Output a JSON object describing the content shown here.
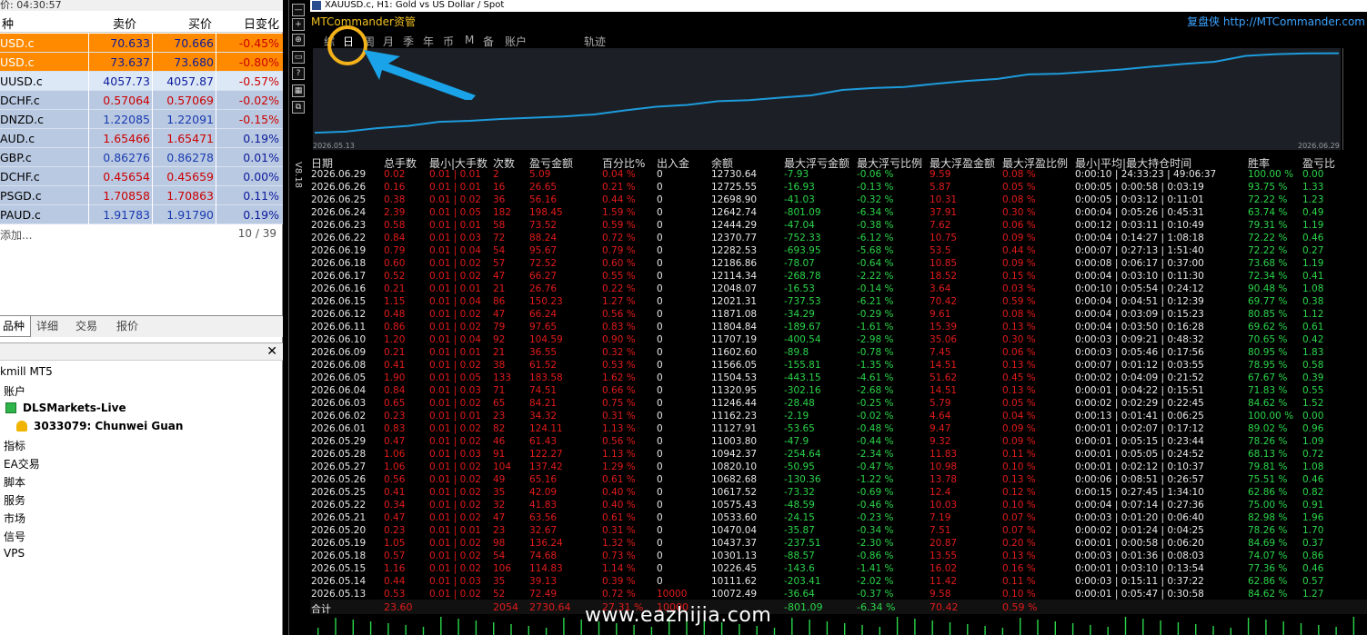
{
  "market_watch": {
    "time_label": "价: 04:30:57",
    "headers": {
      "symbol": "种",
      "bid": "卖价",
      "ask": "买价",
      "change": "日变化"
    },
    "rows": [
      {
        "symbol": "USD.c",
        "bid": "70.633",
        "ask": "70.666",
        "change": "-0.45%",
        "bg": "#ff8a00",
        "change_color": "#cc0000",
        "price_color": "#0b1a9a"
      },
      {
        "symbol": "USD.c",
        "bid": "73.637",
        "ask": "73.680",
        "change": "-0.80%",
        "bg": "#ff8a00",
        "change_color": "#cc0000",
        "price_color": "#0b1a9a"
      },
      {
        "symbol": "UUSD.c",
        "bid": "4057.73",
        "ask": "4057.87",
        "change": "-0.57%",
        "bg": "#dde8f7",
        "change_color": "#cc0000",
        "price_color": "#0b1a9a"
      },
      {
        "symbol": "DCHF.c",
        "bid": "0.57064",
        "ask": "0.57069",
        "change": "-0.02%",
        "bg": "#b9c9e2",
        "change_color": "#cc0000",
        "price_color": "#cc0000"
      },
      {
        "symbol": "DNZD.c",
        "bid": "1.22085",
        "ask": "1.22091",
        "change": "-0.15%",
        "bg": "#b9c9e2",
        "change_color": "#cc0000",
        "price_color": "#1a3ab0"
      },
      {
        "symbol": "AUD.c",
        "bid": "1.65466",
        "ask": "1.65471",
        "change": "0.19%",
        "bg": "#b9c9e2",
        "change_color": "#0b1a9a",
        "price_color": "#cc0000"
      },
      {
        "symbol": "GBP.c",
        "bid": "0.86276",
        "ask": "0.86278",
        "change": "0.01%",
        "bg": "#b9c9e2",
        "change_color": "#0b1a9a",
        "price_color": "#1a3ab0"
      },
      {
        "symbol": "DCHF.c",
        "bid": "0.45654",
        "ask": "0.45659",
        "change": "0.00%",
        "bg": "#b9c9e2",
        "change_color": "#0b1a9a",
        "price_color": "#cc0000"
      },
      {
        "symbol": "PSGD.c",
        "bid": "1.70858",
        "ask": "1.70863",
        "change": "0.11%",
        "bg": "#b9c9e2",
        "change_color": "#0b1a9a",
        "price_color": "#cc0000"
      },
      {
        "symbol": "PAUD.c",
        "bid": "1.91783",
        "ask": "1.91790",
        "change": "0.19%",
        "bg": "#b9c9e2",
        "change_color": "#0b1a9a",
        "price_color": "#1a3ab0"
      }
    ],
    "add_label": "添加...",
    "count": "10 / 39",
    "tabs": [
      "品种",
      "详细",
      "交易",
      "报价"
    ]
  },
  "navigator": {
    "items": [
      {
        "label": "kmill MT5",
        "bold": false,
        "icon": ""
      },
      {
        "label": "账户",
        "bold": false,
        "icon": ""
      },
      {
        "label": "DLSMarkets-Live",
        "bold": true,
        "icon": "server-icon"
      },
      {
        "label": "3033079: Chunwei Guan",
        "bold": true,
        "icon": "user-icon"
      },
      {
        "label": "指标",
        "bold": false,
        "icon": ""
      },
      {
        "label": "EA交易",
        "bold": false,
        "icon": ""
      },
      {
        "label": "脚本",
        "bold": false,
        "icon": ""
      },
      {
        "label": "服务",
        "bold": false,
        "icon": ""
      },
      {
        "label": "市场",
        "bold": false,
        "icon": ""
      },
      {
        "label": "信号",
        "bold": false,
        "icon": ""
      },
      {
        "label": "VPS",
        "bold": false,
        "icon": ""
      }
    ]
  },
  "chart": {
    "title": "XAUUSD.c, H1:  Gold vs US Dollar / Spot",
    "mtc_label": "MTCommander资管",
    "site_label": "复盘侠 http://MTCommander.com",
    "menu": [
      "综",
      "日",
      "周",
      "月",
      "季",
      "年",
      "币",
      "M",
      "备",
      "账户",
      "轨迹"
    ],
    "version": "V8.18",
    "date_start": "2026.05.13",
    "date_end": "2026.06.29",
    "watermark": "www.eazhijia.com"
  },
  "chart_data": {
    "type": "line",
    "title": "",
    "x": [
      "2026.05.13",
      "2026.05.14",
      "2026.05.15",
      "2026.05.18",
      "2026.05.19",
      "2026.05.20",
      "2026.05.21",
      "2026.05.22",
      "2026.05.25",
      "2026.05.26",
      "2026.05.27",
      "2026.05.28",
      "2026.05.29",
      "2026.06.01",
      "2026.06.02",
      "2026.06.03",
      "2026.06.04",
      "2026.06.05",
      "2026.06.08",
      "2026.06.09",
      "2026.06.10",
      "2026.06.11",
      "2026.06.12",
      "2026.06.15",
      "2026.06.16",
      "2026.06.17",
      "2026.06.18",
      "2026.06.19",
      "2026.06.22",
      "2026.06.23",
      "2026.06.24",
      "2026.06.25",
      "2026.06.26",
      "2026.06.29"
    ],
    "series": [
      {
        "values": [
          10072.49,
          10111.62,
          10226.45,
          10301.13,
          10437.37,
          10470.04,
          10533.6,
          10575.43,
          10617.52,
          10682.68,
          10820.1,
          10942.37,
          11003.8,
          11127.91,
          11162.23,
          11246.44,
          11320.95,
          11504.53,
          11566.05,
          11602.6,
          11707.19,
          11804.84,
          11871.08,
          12021.31,
          12048.07,
          12114.34,
          12186.86,
          12282.53,
          12370.77,
          12444.29,
          12642.74,
          12698.9,
          12725.55,
          12730.64
        ]
      }
    ],
    "xlabel": "",
    "ylabel": ""
  },
  "table": {
    "headers": [
      "日期",
      "总手数",
      "最小|大手数",
      "次数",
      "盈亏金额",
      "百分比%",
      "出入金",
      "余额",
      "最大浮亏金额",
      "最大浮亏比例",
      "最大浮盈金额",
      "最大浮盈比例",
      "最小|平均|最大持仓时间",
      "胜率",
      "盈亏比"
    ],
    "rows": [
      [
        "2026.06.29",
        "0.02",
        "0.01 | 0.01",
        "2",
        "5.09",
        "0.04 %",
        "0",
        "12730.64",
        "-7.93",
        "-0.06 %",
        "9.59",
        "0.08 %",
        "0:00:10 | 24:33:23 | 49:06:37",
        "100.00 %",
        "0.00"
      ],
      [
        "2026.06.26",
        "0.16",
        "0.01 | 0.01",
        "16",
        "26.65",
        "0.21 %",
        "0",
        "12725.55",
        "-16.93",
        "-0.13 %",
        "5.87",
        "0.05 %",
        "0:00:05 | 0:00:58 | 0:03:19",
        "93.75 %",
        "1.33"
      ],
      [
        "2026.06.25",
        "0.38",
        "0.01 | 0.02",
        "36",
        "56.16",
        "0.44 %",
        "0",
        "12698.90",
        "-41.03",
        "-0.32 %",
        "10.31",
        "0.08 %",
        "0:00:05 | 0:03:12 | 0:11:01",
        "72.22 %",
        "1.23"
      ],
      [
        "2026.06.24",
        "2.39",
        "0.01 | 0.05",
        "182",
        "198.45",
        "1.59 %",
        "0",
        "12642.74",
        "-801.09",
        "-6.34 %",
        "37.91",
        "0.30 %",
        "0:00:04 | 0:05:26 | 0:45:31",
        "63.74 %",
        "0.49"
      ],
      [
        "2026.06.23",
        "0.58",
        "0.01 | 0.01",
        "58",
        "73.52",
        "0.59 %",
        "0",
        "12444.29",
        "-47.04",
        "-0.38 %",
        "7.62",
        "0.06 %",
        "0:00:12 | 0:03:11 | 0:10:49",
        "79.31 %",
        "1.19"
      ],
      [
        "2026.06.22",
        "0.84",
        "0.01 | 0.03",
        "72",
        "88.24",
        "0.72 %",
        "0",
        "12370.77",
        "-752.33",
        "-6.12 %",
        "10.75",
        "0.09 %",
        "0:00:04 | 0:14:27 | 1:08:18",
        "72.22 %",
        "0.46"
      ],
      [
        "2026.06.19",
        "0.79",
        "0.01 | 0.04",
        "54",
        "95.67",
        "0.79 %",
        "0",
        "12282.53",
        "-693.95",
        "-5.68 %",
        "53.5",
        "0.44 %",
        "0:00:07 | 0:27:13 | 1:51:40",
        "72.22 %",
        "0.27"
      ],
      [
        "2026.06.18",
        "0.60",
        "0.01 | 0.02",
        "57",
        "72.52",
        "0.60 %",
        "0",
        "12186.86",
        "-78.07",
        "-0.64 %",
        "10.85",
        "0.09 %",
        "0:00:08 | 0:06:17 | 0:37:00",
        "73.68 %",
        "1.19"
      ],
      [
        "2026.06.17",
        "0.52",
        "0.01 | 0.02",
        "47",
        "66.27",
        "0.55 %",
        "0",
        "12114.34",
        "-268.78",
        "-2.22 %",
        "18.52",
        "0.15 %",
        "0:00:04 | 0:03:10 | 0:11:30",
        "72.34 %",
        "0.41"
      ],
      [
        "2026.06.16",
        "0.21",
        "0.01 | 0.01",
        "21",
        "26.76",
        "0.22 %",
        "0",
        "12048.07",
        "-16.53",
        "-0.14 %",
        "3.64",
        "0.03 %",
        "0:00:10 | 0:05:54 | 0:24:12",
        "90.48 %",
        "1.08"
      ],
      [
        "2026.06.15",
        "1.15",
        "0.01 | 0.04",
        "86",
        "150.23",
        "1.27 %",
        "0",
        "12021.31",
        "-737.53",
        "-6.21 %",
        "70.42",
        "0.59 %",
        "0:00:04 | 0:04:51 | 0:12:39",
        "69.77 %",
        "0.38"
      ],
      [
        "2026.06.12",
        "0.48",
        "0.01 | 0.02",
        "47",
        "66.24",
        "0.56 %",
        "0",
        "11871.08",
        "-34.29",
        "-0.29 %",
        "9.61",
        "0.08 %",
        "0:00:04 | 0:03:09 | 0:15:23",
        "80.85 %",
        "1.12"
      ],
      [
        "2026.06.11",
        "0.86",
        "0.01 | 0.02",
        "79",
        "97.65",
        "0.83 %",
        "0",
        "11804.84",
        "-189.67",
        "-1.61 %",
        "15.39",
        "0.13 %",
        "0:00:04 | 0:03:50 | 0:16:28",
        "69.62 %",
        "0.61"
      ],
      [
        "2026.06.10",
        "1.20",
        "0.01 | 0.04",
        "92",
        "104.59",
        "0.90 %",
        "0",
        "11707.19",
        "-400.54",
        "-2.98 %",
        "35.06",
        "0.30 %",
        "0:00:03 | 0:09:21 | 0:48:32",
        "70.65 %",
        "0.42"
      ],
      [
        "2026.06.09",
        "0.21",
        "0.01 | 0.01",
        "21",
        "36.55",
        "0.32 %",
        "0",
        "11602.60",
        "-89.8",
        "-0.78 %",
        "7.45",
        "0.06 %",
        "0:00:03 | 0:05:46 | 0:17:56",
        "80.95 %",
        "1.83"
      ],
      [
        "2026.06.08",
        "0.41",
        "0.01 | 0.02",
        "38",
        "61.52",
        "0.53 %",
        "0",
        "11566.05",
        "-155.81",
        "-1.35 %",
        "14.51",
        "0.13 %",
        "0:00:07 | 0:01:12 | 0:03:55",
        "78.95 %",
        "0.58"
      ],
      [
        "2026.06.05",
        "1.90",
        "0.01 | 0.05",
        "133",
        "183.58",
        "1.62 %",
        "0",
        "11504.53",
        "-443.15",
        "-4.61 %",
        "51.62",
        "0.45 %",
        "0:00:02 | 0:04:09 | 0:21:52",
        "67.67 %",
        "0.39"
      ],
      [
        "2026.06.04",
        "0.84",
        "0.01 | 0.03",
        "71",
        "74.51",
        "0.66 %",
        "0",
        "11320.95",
        "-302.16",
        "-2.68 %",
        "14.51",
        "0.13 %",
        "0:00:01 | 0:04:22 | 0:15:51",
        "71.83 %",
        "0.55"
      ],
      [
        "2026.06.03",
        "0.65",
        "0.01 | 0.02",
        "65",
        "84.21",
        "0.75 %",
        "0",
        "11246.44",
        "-28.48",
        "-0.25 %",
        "5.79",
        "0.05 %",
        "0:00:02 | 0:02:29 | 0:22:45",
        "84.62 %",
        "1.52"
      ],
      [
        "2026.06.02",
        "0.23",
        "0.01 | 0.01",
        "23",
        "34.32",
        "0.31 %",
        "0",
        "11162.23",
        "-2.19",
        "-0.02 %",
        "4.64",
        "0.04 %",
        "0:00:13 | 0:01:41 | 0:06:25",
        "100.00 %",
        "0.00"
      ],
      [
        "2026.06.01",
        "0.83",
        "0.01 | 0.02",
        "82",
        "124.11",
        "1.13 %",
        "0",
        "11127.91",
        "-53.65",
        "-0.48 %",
        "9.47",
        "0.09 %",
        "0:00:01 | 0:02:07 | 0:17:12",
        "89.02 %",
        "0.96"
      ],
      [
        "2026.05.29",
        "0.47",
        "0.01 | 0.02",
        "46",
        "61.43",
        "0.56 %",
        "0",
        "11003.80",
        "-47.9",
        "-0.44 %",
        "9.32",
        "0.09 %",
        "0:00:01 | 0:05:15 | 0:23:44",
        "78.26 %",
        "1.09"
      ],
      [
        "2026.05.28",
        "1.06",
        "0.01 | 0.03",
        "91",
        "122.27",
        "1.13 %",
        "0",
        "10942.37",
        "-254.64",
        "-2.34 %",
        "11.83",
        "0.11 %",
        "0:00:01 | 0:05:05 | 0:24:52",
        "68.13 %",
        "0.72"
      ],
      [
        "2026.05.27",
        "1.06",
        "0.01 | 0.02",
        "104",
        "137.42",
        "1.29 %",
        "0",
        "10820.10",
        "-50.95",
        "-0.47 %",
        "10.98",
        "0.10 %",
        "0:00:01 | 0:02:12 | 0:10:37",
        "79.81 %",
        "1.08"
      ],
      [
        "2026.05.26",
        "0.56",
        "0.01 | 0.02",
        "49",
        "65.16",
        "0.61 %",
        "0",
        "10682.68",
        "-130.36",
        "-1.22 %",
        "13.78",
        "0.13 %",
        "0:00:06 | 0:08:51 | 0:26:57",
        "75.51 %",
        "0.46"
      ],
      [
        "2026.05.25",
        "0.41",
        "0.01 | 0.02",
        "35",
        "42.09",
        "0.40 %",
        "0",
        "10617.52",
        "-73.32",
        "-0.69 %",
        "12.4",
        "0.12 %",
        "0:00:15 | 0:27:45 | 1:34:10",
        "62.86 %",
        "0.82"
      ],
      [
        "2026.05.22",
        "0.34",
        "0.01 | 0.02",
        "32",
        "41.83",
        "0.40 %",
        "0",
        "10575.43",
        "-48.59",
        "-0.46 %",
        "10.03",
        "0.10 %",
        "0:00:04 | 0:07:14 | 0:27:36",
        "75.00 %",
        "0.91"
      ],
      [
        "2026.05.21",
        "0.47",
        "0.01 | 0.02",
        "47",
        "63.56",
        "0.61 %",
        "0",
        "10533.60",
        "-24.15",
        "-0.23 %",
        "7.19",
        "0.07 %",
        "0:00:03 | 0:01:20 | 0:06:40",
        "82.98 %",
        "1.96"
      ],
      [
        "2026.05.20",
        "0.23",
        "0.01 | 0.01",
        "23",
        "32.67",
        "0.31 %",
        "0",
        "10470.04",
        "-35.87",
        "-0.34 %",
        "7.51",
        "0.07 %",
        "0:00:02 | 0:01:24 | 0:04:25",
        "78.26 %",
        "1.70"
      ],
      [
        "2026.05.19",
        "1.05",
        "0.01 | 0.02",
        "98",
        "136.24",
        "1.32 %",
        "0",
        "10437.37",
        "-237.51",
        "-2.30 %",
        "20.87",
        "0.20 %",
        "0:00:01 | 0:00:58 | 0:06:20",
        "84.69 %",
        "0.37"
      ],
      [
        "2026.05.18",
        "0.57",
        "0.01 | 0.02",
        "54",
        "74.68",
        "0.73 %",
        "0",
        "10301.13",
        "-88.57",
        "-0.86 %",
        "13.55",
        "0.13 %",
        "0:00:03 | 0:01:36 | 0:08:03",
        "74.07 %",
        "0.86"
      ],
      [
        "2026.05.15",
        "1.16",
        "0.01 | 0.02",
        "106",
        "114.83",
        "1.14 %",
        "0",
        "10226.45",
        "-143.6",
        "-1.41 %",
        "16.02",
        "0.16 %",
        "0:00:01 | 0:03:10 | 0:13:54",
        "77.36 %",
        "0.46"
      ],
      [
        "2026.05.14",
        "0.44",
        "0.01 | 0.03",
        "35",
        "39.13",
        "0.39 %",
        "0",
        "10111.62",
        "-203.41",
        "-2.02 %",
        "11.42",
        "0.11 %",
        "0:00:03 | 0:15:11 | 0:37:22",
        "62.86 %",
        "0.57"
      ],
      [
        "2026.05.13",
        "0.53",
        "0.01 | 0.02",
        "52",
        "72.49",
        "0.72 %",
        "10000",
        "10072.49",
        "-36.64",
        "-0.37 %",
        "9.58",
        "0.10 %",
        "0:00:01 | 0:05:47 | 0:30:58",
        "84.62 %",
        "1.27"
      ]
    ],
    "totals": {
      "label": "合计",
      "lots": "23.60",
      "count": "2054",
      "pnl": "2730.64",
      "pct": "27.31 %",
      "deposit": "10000",
      "max_loss": "-801.09",
      "max_loss_pct": "-6.34 %",
      "max_gain": "70.42",
      "max_gain_pct": "0.59 %"
    }
  }
}
